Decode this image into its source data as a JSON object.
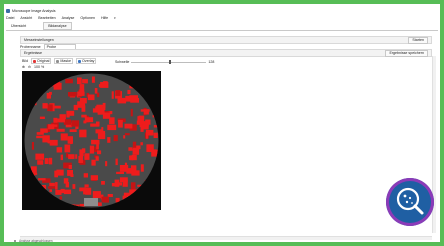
{
  "window": {
    "title": "Microscope Image Analysis"
  },
  "menu": [
    "Datei",
    "Ansicht",
    "Bearbeiten",
    "Analyse",
    "Optionen",
    "Hilfe"
  ],
  "tabs": [
    "Übersicht",
    "Bildanalyse"
  ],
  "sections": {
    "measurement_settings": "Messeinstellungen",
    "results": "Ergebnisse",
    "export_button": "Ergebnisse speichern",
    "start_button": "Starten",
    "input_label": "Probenname",
    "input_value": "Probe"
  },
  "toolbar": {
    "label": "Bild",
    "layer_items": [
      "Original",
      "Maske",
      "Overlay"
    ],
    "zoom_label": "100 %"
  },
  "slider": {
    "label": "Schwelle",
    "value_text": "128",
    "value": 0.5
  },
  "status": {
    "text": "Analyse abgeschlossen"
  }
}
